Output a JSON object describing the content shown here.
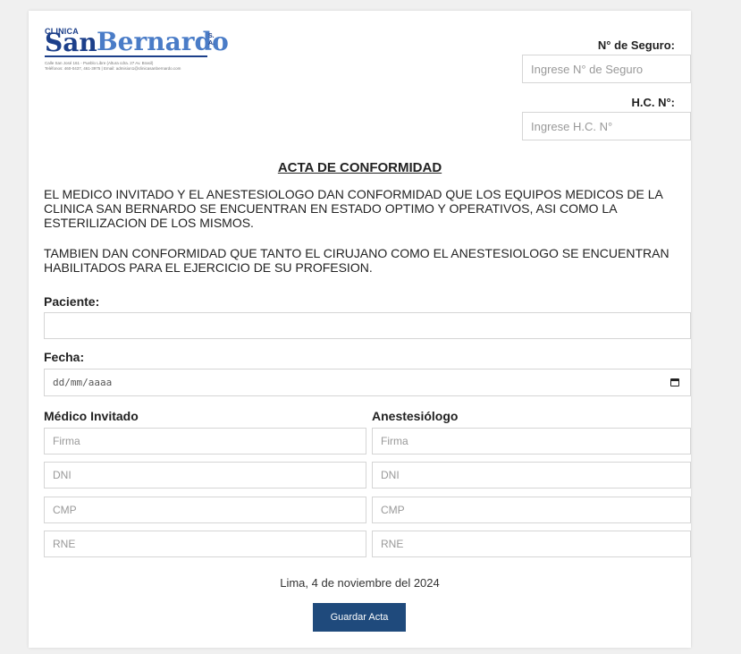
{
  "logo": {
    "clinica": "CLINICA",
    "san": "San",
    "bernardo": "Bernardo",
    "sa": "S. A.",
    "address_line1": "Calle San José 161 - Pueblo Libre (Altura cdra. 27 Av. Brasil)",
    "address_line2": "Teléfonos: 460-0437, 461-3975 | Email: admision1@clinicasanbernardo.com"
  },
  "seguro": {
    "label": "N° de Seguro:",
    "placeholder": "Ingrese N° de Seguro"
  },
  "hc": {
    "label": "H.C. N°:",
    "placeholder": "Ingrese H.C. N°"
  },
  "title": "ACTA DE CONFORMIDAD",
  "paragraphs": [
    "EL MEDICO INVITADO Y EL ANESTESIOLOGO DAN CONFORMIDAD QUE LOS EQUIPOS MEDICOS DE LA CLINICA SAN BERNARDO SE ENCUENTRAN EN ESTADO OPTIMO Y OPERATIVOS, ASI COMO LA ESTERILIZACION DE LOS MISMOS.",
    "TAMBIEN DAN CONFORMIDAD QUE TANTO EL CIRUJANO COMO EL ANESTESIOLOGO SE ENCUENTRAN HABILITADOS PARA EL EJERCICIO DE SU PROFESION."
  ],
  "paciente": {
    "label": "Paciente:",
    "value": ""
  },
  "fecha": {
    "label": "Fecha:",
    "placeholder": "dd/mm/aaaa",
    "icon": "calendar-icon"
  },
  "medico": {
    "label": "Médico Invitado",
    "fields": [
      "Firma",
      "DNI",
      "CMP",
      "RNE"
    ]
  },
  "anestesiologo": {
    "label": "Anestesiólogo",
    "fields": [
      "Firma",
      "DNI",
      "CMP",
      "RNE"
    ]
  },
  "footer_date": "Lima, 4 de noviembre del 2024",
  "save_button": "Guardar Acta",
  "colors": {
    "brand_dark": "#1c3f8a",
    "brand_light": "#4a7cc7",
    "button": "#1f4a7c"
  }
}
